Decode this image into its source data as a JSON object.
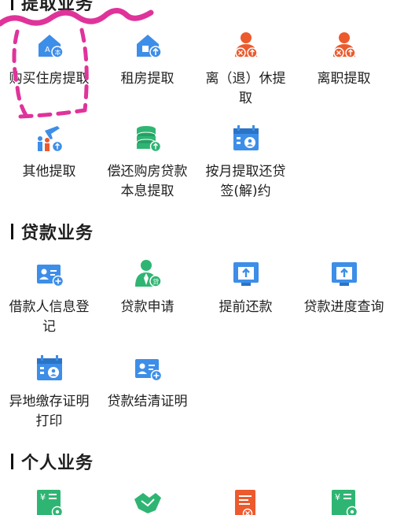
{
  "sections": [
    {
      "title": "提取业务",
      "items": [
        {
          "label": "购买住房提取",
          "icon": "house-buy-icon"
        },
        {
          "label": "租房提取",
          "icon": "house-rent-icon"
        },
        {
          "label": "离（退）休提取",
          "icon": "retire-person-icon"
        },
        {
          "label": "离职提取",
          "icon": "resign-person-icon"
        },
        {
          "label": "其他提取",
          "icon": "travel-family-icon"
        },
        {
          "label": "偿还购房贷款本息提取",
          "icon": "coin-stack-icon"
        },
        {
          "label": "按月提取还贷签(解)约",
          "icon": "calendar-person-icon"
        }
      ]
    },
    {
      "title": "贷款业务",
      "items": [
        {
          "label": "借款人信息登记",
          "icon": "id-card-add-icon"
        },
        {
          "label": "贷款申请",
          "icon": "loan-person-icon"
        },
        {
          "label": "提前还款",
          "icon": "upload-tray-icon"
        },
        {
          "label": "贷款进度查询",
          "icon": "upload-tray-icon"
        },
        {
          "label": "异地缴存证明打印",
          "icon": "calendar-person-icon"
        },
        {
          "label": "贷款结清证明",
          "icon": "id-card-add-icon"
        }
      ]
    },
    {
      "title": "个人业务",
      "items": [
        {
          "label": "",
          "icon": "yuan-gear-icon"
        },
        {
          "label": "",
          "icon": "handshake-icon"
        },
        {
          "label": "",
          "icon": "document-close-icon"
        },
        {
          "label": "",
          "icon": "yuan-gear-icon"
        }
      ]
    }
  ],
  "colors": {
    "blue": "#3d8ee8",
    "green": "#2fb573",
    "orange": "#ec5a2d",
    "pink": "#e0339a"
  }
}
